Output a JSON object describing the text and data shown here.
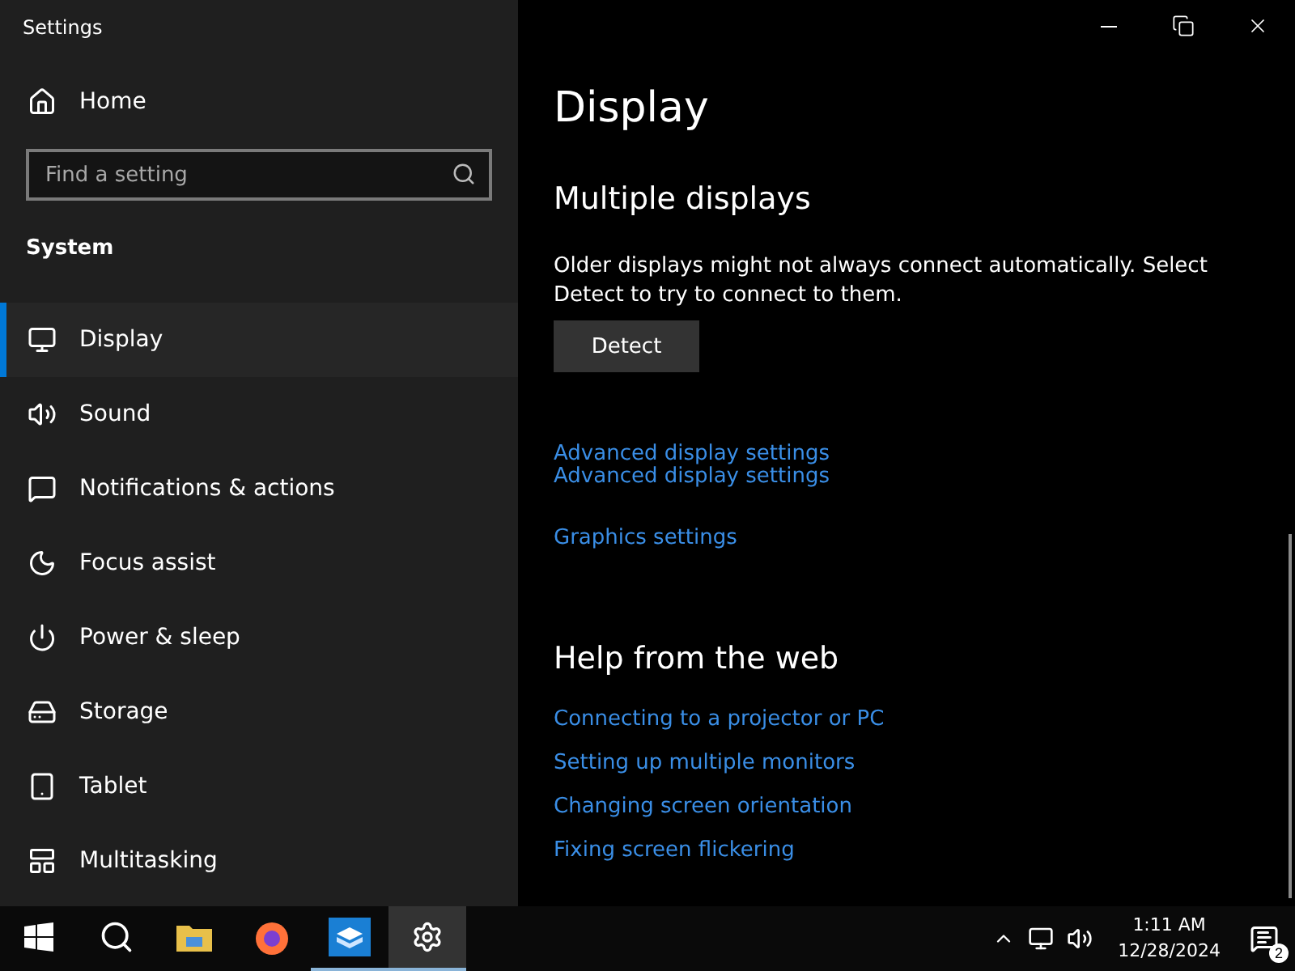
{
  "window": {
    "title": "Settings"
  },
  "sidebar": {
    "home": "Home",
    "search": {
      "placeholder": "Find a setting"
    },
    "section": "System",
    "items": [
      {
        "label": "Display",
        "selected": true
      },
      {
        "label": "Sound",
        "selected": false
      },
      {
        "label": "Notifications & actions",
        "selected": false
      },
      {
        "label": "Focus assist",
        "selected": false
      },
      {
        "label": "Power & sleep",
        "selected": false
      },
      {
        "label": "Storage",
        "selected": false
      },
      {
        "label": "Tablet",
        "selected": false
      },
      {
        "label": "Multitasking",
        "selected": false
      }
    ]
  },
  "content": {
    "title": "Display",
    "sections": [
      {
        "heading": "Multiple displays",
        "text": "Older displays might not always connect automatically. Select Detect to try to connect to them.",
        "button": "Detect",
        "link_groups": [
          [
            "Advanced display settings",
            "Advanced display settings"
          ],
          [
            "Graphics settings"
          ]
        ]
      },
      {
        "heading": "Help from the web",
        "link_groups": [
          [
            "Connecting to a projector or PC",
            "Setting up multiple monitors",
            "Changing screen orientation",
            "Fixing screen flickering"
          ]
        ]
      }
    ]
  },
  "taskbar": {
    "apps": [
      {
        "running": false,
        "selected": false
      },
      {
        "running": false,
        "selected": false
      },
      {
        "running": false,
        "selected": false
      },
      {
        "running": false,
        "selected": false
      },
      {
        "running": true,
        "selected": false
      },
      {
        "running": true,
        "selected": true
      }
    ],
    "time": "1:11 AM",
    "date": "12/28/2024",
    "notifications": "2"
  }
}
